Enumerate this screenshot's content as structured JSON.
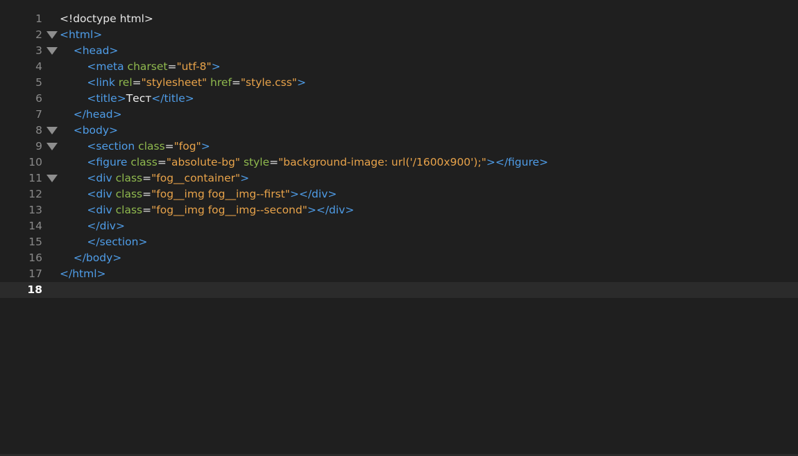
{
  "editor": {
    "active_line": 18,
    "lines": [
      {
        "num": "1",
        "fold": false,
        "indent": "",
        "tokens": [
          [
            "doctype",
            "<!doctype html>"
          ]
        ]
      },
      {
        "num": "2",
        "fold": true,
        "indent": "",
        "tokens": [
          [
            "tag",
            "<html>"
          ]
        ]
      },
      {
        "num": "3",
        "fold": true,
        "indent": "    ",
        "tokens": [
          [
            "tag",
            "<head>"
          ]
        ]
      },
      {
        "num": "4",
        "fold": false,
        "indent": "        ",
        "tokens": [
          [
            "tag",
            "<meta "
          ],
          [
            "attr",
            "charset"
          ],
          [
            "eq",
            "="
          ],
          [
            "str",
            "\"utf-8\""
          ],
          [
            "tag",
            ">"
          ]
        ]
      },
      {
        "num": "5",
        "fold": false,
        "indent": "        ",
        "tokens": [
          [
            "tag",
            "<link "
          ],
          [
            "attr",
            "rel"
          ],
          [
            "eq",
            "="
          ],
          [
            "str",
            "\"stylesheet\""
          ],
          [
            "tag",
            " "
          ],
          [
            "attr",
            "href"
          ],
          [
            "eq",
            "="
          ],
          [
            "str",
            "\"style.css\""
          ],
          [
            "tag",
            ">"
          ]
        ]
      },
      {
        "num": "6",
        "fold": false,
        "indent": "        ",
        "tokens": [
          [
            "tag",
            "<title>"
          ],
          [
            "text",
            "Тест"
          ],
          [
            "tag",
            "</title>"
          ]
        ]
      },
      {
        "num": "7",
        "fold": false,
        "indent": "    ",
        "tokens": [
          [
            "tag",
            "</head>"
          ]
        ]
      },
      {
        "num": "8",
        "fold": true,
        "indent": "    ",
        "tokens": [
          [
            "tag",
            "<body>"
          ]
        ]
      },
      {
        "num": "9",
        "fold": true,
        "indent": "        ",
        "tokens": [
          [
            "tag",
            "<section "
          ],
          [
            "attr",
            "class"
          ],
          [
            "eq",
            "="
          ],
          [
            "str",
            "\"fog\""
          ],
          [
            "tag",
            ">"
          ]
        ]
      },
      {
        "num": "10",
        "fold": false,
        "indent": "        ",
        "tokens": [
          [
            "tag",
            "<figure "
          ],
          [
            "attr",
            "class"
          ],
          [
            "eq",
            "="
          ],
          [
            "str",
            "\"absolute-bg\""
          ],
          [
            "tag",
            " "
          ],
          [
            "attr",
            "style"
          ],
          [
            "eq",
            "="
          ],
          [
            "str",
            "\"background-image: url('/1600x900');\""
          ],
          [
            "tag",
            "></figure>"
          ]
        ]
      },
      {
        "num": "11",
        "fold": true,
        "indent": "        ",
        "tokens": [
          [
            "tag",
            "<div "
          ],
          [
            "attr",
            "class"
          ],
          [
            "eq",
            "="
          ],
          [
            "str",
            "\"fog__container\""
          ],
          [
            "tag",
            ">"
          ]
        ]
      },
      {
        "num": "12",
        "fold": false,
        "indent": "        ",
        "tokens": [
          [
            "tag",
            "<div "
          ],
          [
            "attr",
            "class"
          ],
          [
            "eq",
            "="
          ],
          [
            "str",
            "\"fog__img fog__img--first\""
          ],
          [
            "tag",
            "></div>"
          ]
        ]
      },
      {
        "num": "13",
        "fold": false,
        "indent": "        ",
        "tokens": [
          [
            "tag",
            "<div "
          ],
          [
            "attr",
            "class"
          ],
          [
            "eq",
            "="
          ],
          [
            "str",
            "\"fog__img fog__img--second\""
          ],
          [
            "tag",
            "></div>"
          ]
        ]
      },
      {
        "num": "14",
        "fold": false,
        "indent": "        ",
        "tokens": [
          [
            "tag",
            "</div>"
          ]
        ]
      },
      {
        "num": "15",
        "fold": false,
        "indent": "        ",
        "tokens": [
          [
            "tag",
            "</section>"
          ]
        ]
      },
      {
        "num": "16",
        "fold": false,
        "indent": "    ",
        "tokens": [
          [
            "tag",
            "</body>"
          ]
        ]
      },
      {
        "num": "17",
        "fold": false,
        "indent": "",
        "tokens": [
          [
            "tag",
            "</html>"
          ]
        ]
      },
      {
        "num": "18",
        "fold": false,
        "indent": "",
        "tokens": []
      }
    ]
  },
  "colors": {
    "background": "#1f1f1f",
    "tag": "#4f9de8",
    "attribute": "#8fb94e",
    "string": "#e8a34a",
    "text": "#f0f0f0",
    "line_number": "#8a8a8a",
    "active_line_bg": "#2b2b2b"
  },
  "icons": {
    "fold": "fold-triangle-icon"
  }
}
